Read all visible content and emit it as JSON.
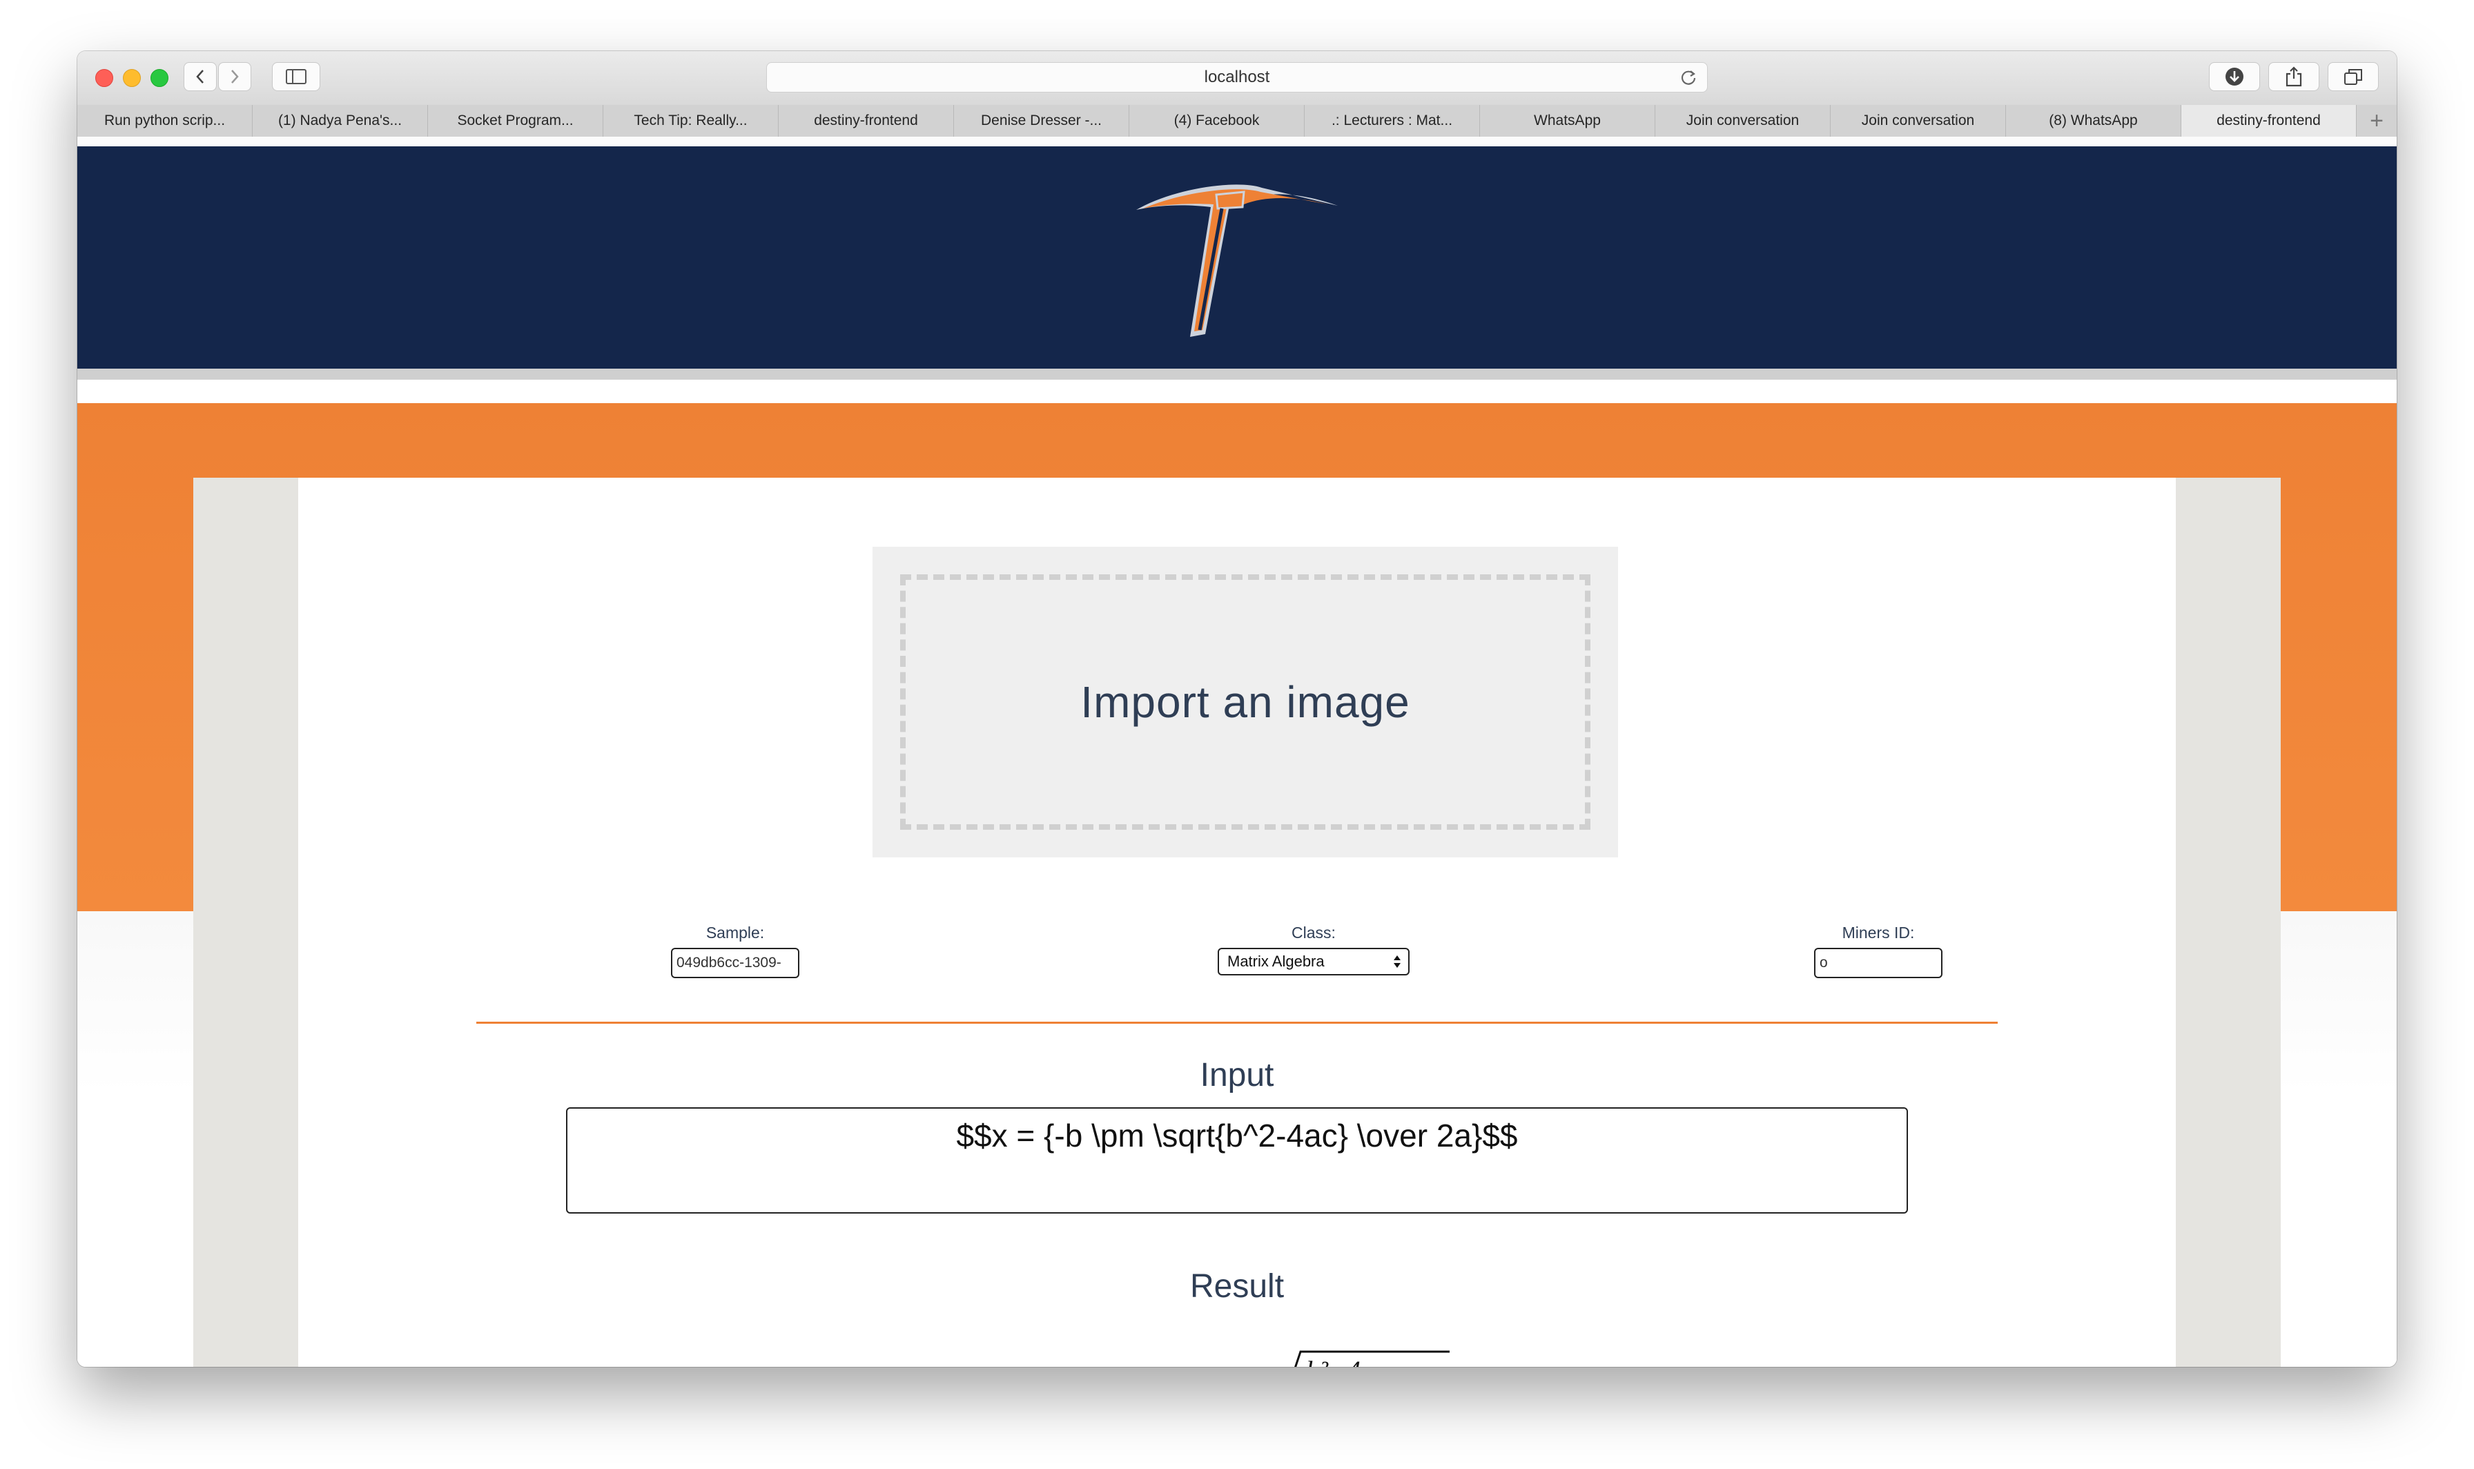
{
  "browser": {
    "url": "localhost",
    "tabs": [
      {
        "label": "Run python scrip..."
      },
      {
        "label": "(1) Nadya Pena's..."
      },
      {
        "label": "Socket Program..."
      },
      {
        "label": "Tech Tip: Really..."
      },
      {
        "label": "destiny-frontend"
      },
      {
        "label": "Denise Dresser -..."
      },
      {
        "label": "(4) Facebook"
      },
      {
        "label": ".: Lecturers : Mat..."
      },
      {
        "label": "WhatsApp"
      },
      {
        "label": "Join conversation"
      },
      {
        "label": "Join conversation"
      },
      {
        "label": "(8) WhatsApp"
      },
      {
        "label": "destiny-frontend"
      }
    ],
    "active_tab_index": 12,
    "new_tab_label": "+"
  },
  "header": {
    "logo_icon": "pickaxe-logo-icon"
  },
  "upload": {
    "label": "Import an image"
  },
  "form": {
    "sample_label": "Sample:",
    "sample_value": "049db6cc-1309-",
    "class_label": "Class:",
    "class_value": "Matrix Algebra",
    "miners_label": "Miners ID:",
    "miners_value": "o"
  },
  "input_section": {
    "heading": "Input",
    "value": "$$x = {-b \\pm \\sqrt{b^2-4ac} \\over 2a}$$"
  },
  "result_section": {
    "heading": "Result",
    "partial_render": "b²−4"
  },
  "colors": {
    "navy": "#14264b",
    "orange": "#ee8135",
    "gutter": "#e5e4e0",
    "text": "#2f3e55"
  }
}
